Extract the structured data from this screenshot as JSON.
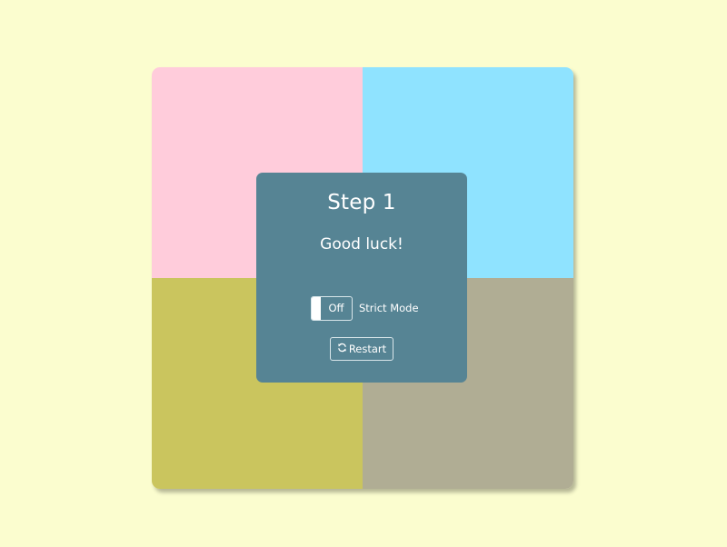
{
  "colors": {
    "background": "#fbfdcf",
    "quad_top_left": "#ffccdb",
    "quad_top_right": "#8fe3ff",
    "quad_bottom_left": "#cac55e",
    "quad_bottom_right": "#b0ad94",
    "panel": "#568494",
    "text": "#ffffff"
  },
  "board": {
    "quadrants": [
      {
        "name": "pink",
        "color": "#ffccdb"
      },
      {
        "name": "blue",
        "color": "#8fe3ff"
      },
      {
        "name": "olive",
        "color": "#cac55e"
      },
      {
        "name": "khaki",
        "color": "#b0ad94"
      }
    ]
  },
  "panel": {
    "step": "Step 1",
    "message": "Good luck!",
    "strict": {
      "toggle_state": "Off",
      "label": "Strict Mode"
    },
    "restart": {
      "label": "Restart",
      "icon": "refresh-icon"
    }
  }
}
